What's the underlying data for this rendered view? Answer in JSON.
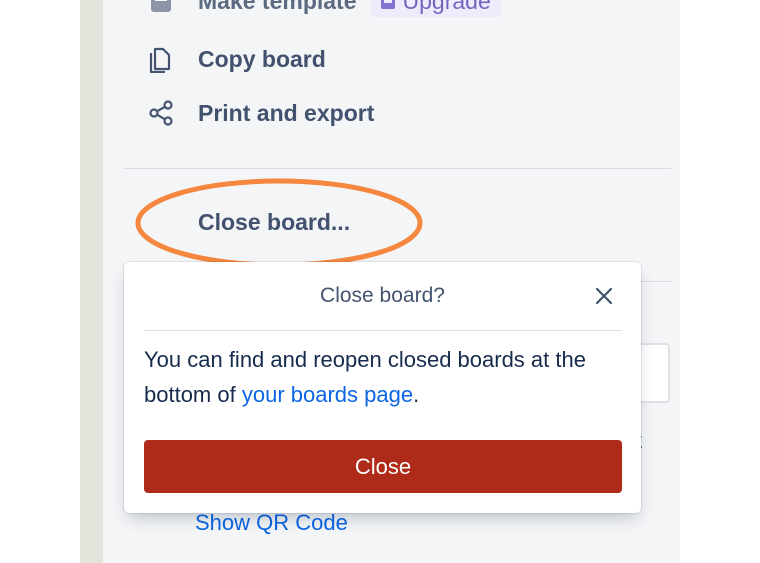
{
  "menu": {
    "make_template": {
      "label": "Make template",
      "upgrade_label": "Upgrade",
      "icon": "template-icon",
      "upgrade_icon": "upgrade-icon"
    },
    "copy_board": {
      "label": "Copy board",
      "icon": "copy-icon"
    },
    "print_export": {
      "label": "Print and export",
      "icon": "share-icon"
    },
    "close_board": {
      "label": "Close board..."
    }
  },
  "popover": {
    "title": "Close board?",
    "close_icon": "close-icon",
    "message_before": "You can find and reopen closed boards at the bottom of ",
    "message_link": "your boards page",
    "message_after": ".",
    "confirm_label": "Close"
  },
  "background": {
    "partial_text": "t",
    "show_qr_label": "Show QR Code"
  },
  "colors": {
    "danger_button": "#ae2a19",
    "link": "#0c66e4",
    "highlight_ellipse": "#f5873f",
    "menu_text": "#42526e",
    "panel_bg": "#f4f5f7"
  }
}
